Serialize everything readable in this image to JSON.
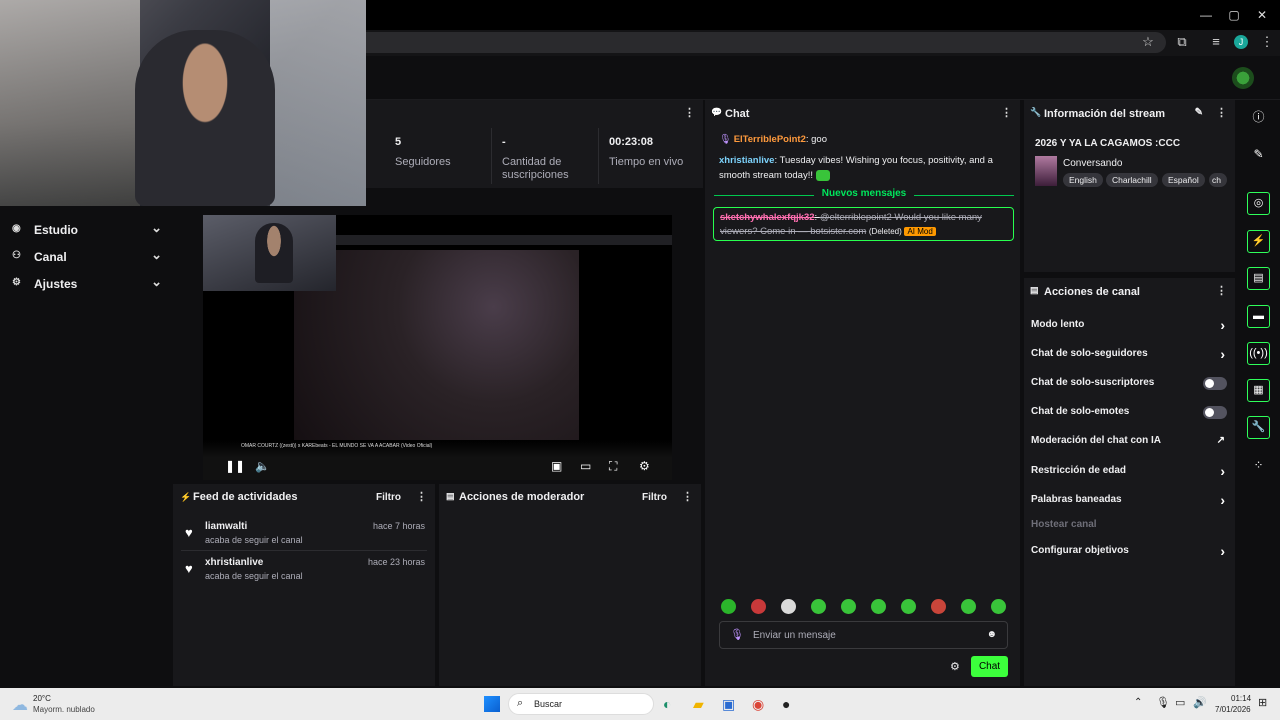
{
  "browser": {
    "window_controls": [
      "—",
      "▢",
      "✕"
    ],
    "address_icons": [
      "star-icon",
      "extensions-icon",
      "media-icon",
      "profile-icon",
      "menu-icon"
    ],
    "profile_initial": "J"
  },
  "sidebar": {
    "items": [
      {
        "label": "Estudio",
        "icon": "studio-icon"
      },
      {
        "label": "Canal",
        "icon": "channel-icon"
      },
      {
        "label": "Ajustes",
        "icon": "settings-icon"
      }
    ]
  },
  "stats": {
    "followers": {
      "value": "5",
      "label": "Seguidores"
    },
    "subs": {
      "value": "-",
      "label": "Cantidad de suscripciones"
    },
    "live": {
      "value": "00:23:08",
      "label": "Tiempo en vivo"
    }
  },
  "video": {
    "title": "OMAR COURTZ ((zesti)) x KAREbeats - EL MUNDO SE VA A ACABAR (Video Oficial)"
  },
  "activity_feed": {
    "title": "Feed de actividades",
    "filter": "Filtro",
    "items": [
      {
        "user": "liamwalti",
        "time": "hace 7 horas",
        "action": "acaba de seguir el canal"
      },
      {
        "user": "xhristianlive",
        "time": "hace 23 horas",
        "action": "acaba de seguir el canal"
      }
    ]
  },
  "mod_actions": {
    "title": "Acciones de moderador",
    "filter": "Filtro"
  },
  "chat": {
    "title": "Chat",
    "messages": [
      {
        "user": "ElTerriblePoint2",
        "color": "#ff9a3d",
        "text": "goo"
      },
      {
        "user": "xhristianlive",
        "color": "#7dd3fc",
        "text": "Tuesday vibes! Wishing you focus, positivity, and a smooth stream today!!"
      }
    ],
    "new_messages_label": "Nuevos mensajes",
    "deleted": {
      "user": "sketchywhalexfqjk32",
      "text": "@elterriblepoint2 Would you like many viewers? Come in — botsister.com",
      "deleted_label": "(Deleted)",
      "badge": "AI Mod"
    },
    "input_placeholder": "Enviar un mensaje",
    "send_label": "Chat",
    "accent": "#3cff3c"
  },
  "stream_info": {
    "header": "Información del stream",
    "title": "2026 Y YA LA CAGAMOS :CCC",
    "category": "Conversando",
    "tags": [
      "English",
      "Charlachill",
      "Español",
      "ch"
    ]
  },
  "channel_actions": {
    "header": "Acciones de canal",
    "rows": [
      {
        "label": "Modo lento",
        "kind": "chevron"
      },
      {
        "label": "Chat de solo-seguidores",
        "kind": "chevron"
      },
      {
        "label": "Chat de solo-suscriptores",
        "kind": "toggle"
      },
      {
        "label": "Chat de solo-emotes",
        "kind": "toggle"
      },
      {
        "label": "Moderación del chat con IA",
        "kind": "external"
      },
      {
        "label": "Restricción de edad",
        "kind": "chevron"
      },
      {
        "label": "Palabras baneadas",
        "kind": "chevron"
      },
      {
        "label": "Hostear canal",
        "kind": "disabled"
      },
      {
        "label": "Configurar objetivos",
        "kind": "chevron"
      }
    ]
  },
  "rail_icons": [
    "info-icon",
    "pencil-icon",
    "camera-icon",
    "bolt-icon",
    "notes-icon",
    "chat-icon",
    "broadcast-icon",
    "layout-icon",
    "wrench-icon",
    "apps-icon"
  ],
  "taskbar": {
    "weather_temp": "20°C",
    "weather_desc": "Mayorm. nublado",
    "search": "Buscar",
    "time": "01:14",
    "date": "7/01/2026"
  }
}
